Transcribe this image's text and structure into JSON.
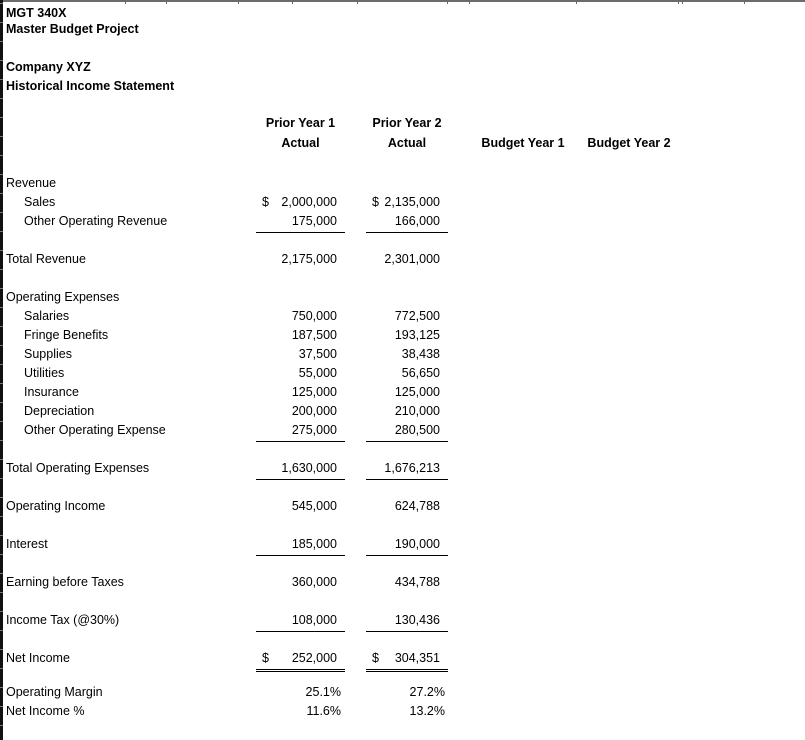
{
  "header": {
    "course": "MGT 340X",
    "project": "Master Budget Project",
    "company": "Company XYZ",
    "statement": "Historical Income Statement"
  },
  "columns": {
    "py1_line1": "Prior Year 1",
    "py1_line2": "Actual",
    "py2_line1": "Prior Year 2",
    "py2_line2": "Actual",
    "by1": "Budget Year 1",
    "by2": "Budget Year 2"
  },
  "currency_symbol": "$",
  "revenue": {
    "heading": "Revenue",
    "items": [
      {
        "label": "Sales",
        "py1": "2,000,000",
        "py2": "2,135,000"
      },
      {
        "label": "Other Operating Revenue",
        "py1": "175,000",
        "py2": "166,000"
      }
    ],
    "total": {
      "label": "Total Revenue",
      "py1": "2,175,000",
      "py2": "2,301,000"
    }
  },
  "expenses": {
    "heading": "Operating Expenses",
    "items": [
      {
        "label": "Salaries",
        "py1": "750,000",
        "py2": "772,500"
      },
      {
        "label": "Fringe Benefits",
        "py1": "187,500",
        "py2": "193,125"
      },
      {
        "label": "Supplies",
        "py1": "37,500",
        "py2": "38,438"
      },
      {
        "label": "Utilities",
        "py1": "55,000",
        "py2": "56,650"
      },
      {
        "label": "Insurance",
        "py1": "125,000",
        "py2": "125,000"
      },
      {
        "label": "Depreciation",
        "py1": "200,000",
        "py2": "210,000"
      },
      {
        "label": "Other Operating Expense",
        "py1": "275,000",
        "py2": "280,500"
      }
    ],
    "total": {
      "label": "Total Operating Expenses",
      "py1": "1,630,000",
      "py2": "1,676,213"
    }
  },
  "operating_income": {
    "label": "Operating Income",
    "py1": "545,000",
    "py2": "624,788"
  },
  "interest": {
    "label": "Interest",
    "py1": "185,000",
    "py2": "190,000"
  },
  "ebt": {
    "label": "Earning before Taxes",
    "py1": "360,000",
    "py2": "434,788"
  },
  "income_tax": {
    "label": "Income Tax (@30%)",
    "py1": "108,000",
    "py2": "130,436"
  },
  "net_income": {
    "label": "Net Income",
    "py1": "252,000",
    "py2": "304,351"
  },
  "ratios": [
    {
      "label": "Operating Margin",
      "py1": "25.1%",
      "py2": "27.2%"
    },
    {
      "label": "Net Income %",
      "py1": "11.6%",
      "py2": "13.2%"
    }
  ]
}
